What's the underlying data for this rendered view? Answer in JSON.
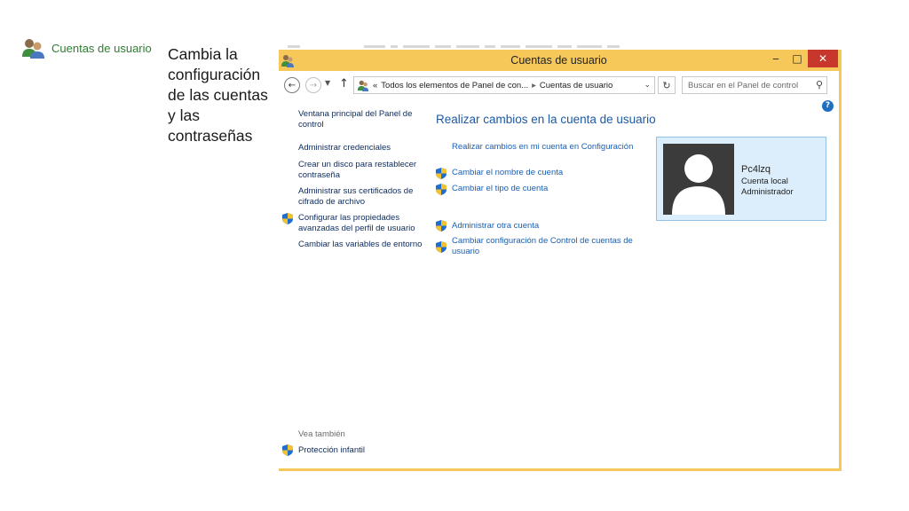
{
  "slide": {
    "heading": "Cuentas de usuario",
    "caption": "Cambia la configuración de las cuentas y las contraseñas"
  },
  "window": {
    "title": "Cuentas de usuario",
    "controls": {
      "minimize": "‒",
      "maximize": "□",
      "close": "✕"
    }
  },
  "address_bar": {
    "chevrons": "«",
    "crumbs": [
      "Todos los elementos de Panel de con...",
      "Cuentas de usuario"
    ],
    "separator": "▸",
    "search_placeholder": "Buscar en el Panel de control"
  },
  "sidebar": {
    "items": [
      {
        "label": "Ventana principal del Panel de control",
        "shield": false
      },
      {
        "label": "Administrar credenciales",
        "shield": false
      },
      {
        "label": "Crear un disco para restablecer contraseña",
        "shield": false
      },
      {
        "label": "Administrar sus certificados de cifrado de archivo",
        "shield": false
      },
      {
        "label": "Configurar las propiedades avanzadas del perfil de usuario",
        "shield": true
      },
      {
        "label": "Cambiar las variables de entorno",
        "shield": false
      }
    ],
    "see_also": "Vea también",
    "see_also_items": [
      {
        "label": "Protección infantil",
        "shield": true
      }
    ]
  },
  "main": {
    "heading": "Realizar cambios en la cuenta de usuario",
    "links": [
      {
        "label": "Realizar cambios en mi cuenta en Configuración",
        "shield": false
      },
      {
        "label": "Cambiar el nombre de cuenta",
        "shield": true
      },
      {
        "label": "Cambiar el tipo de cuenta",
        "shield": true
      },
      {
        "label": "Administrar otra cuenta",
        "shield": true
      },
      {
        "label": "Cambiar configuración de Control de cuentas de usuario",
        "shield": true
      }
    ]
  },
  "account": {
    "name": "Pc4lzq",
    "type": "Cuenta local",
    "role": "Administrador"
  },
  "colors": {
    "title_bar": "#f6c85a",
    "close_button": "#c7372b",
    "link": "#1a5fb4",
    "heading": "#1c5aa6",
    "card_bg": "#dceefb"
  }
}
